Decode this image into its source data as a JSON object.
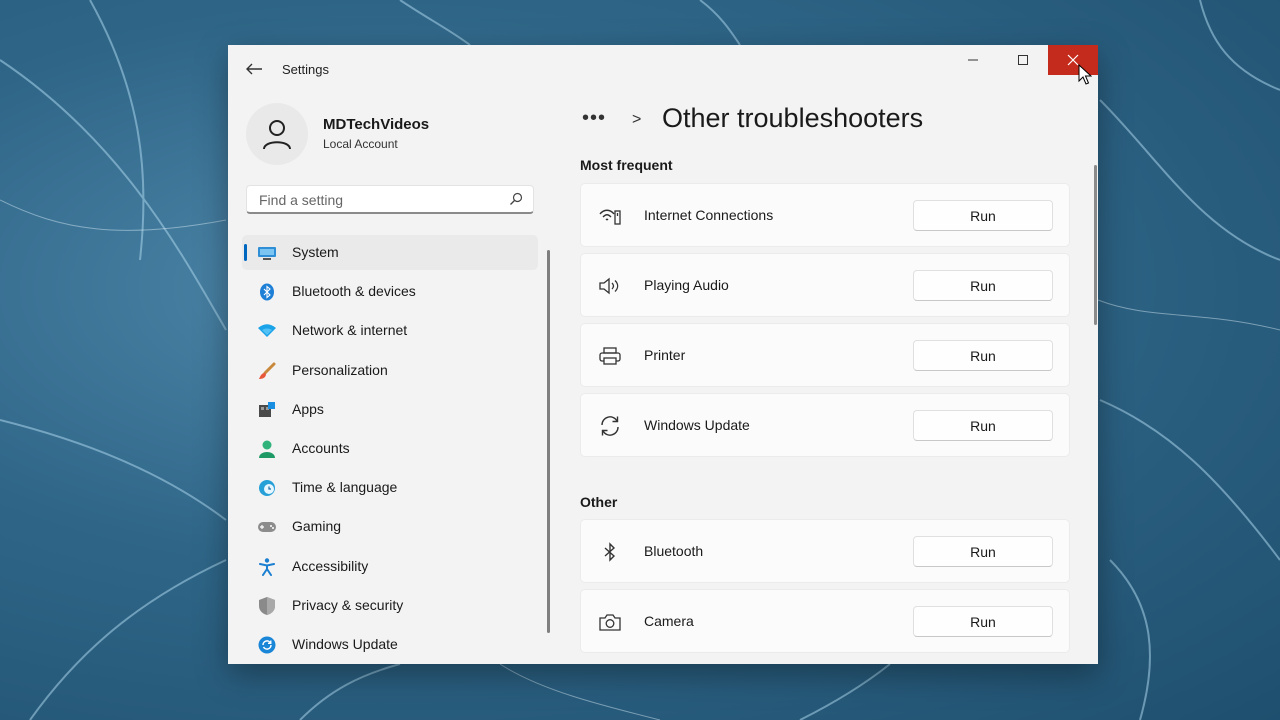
{
  "window": {
    "title": "Settings"
  },
  "profile": {
    "name": "MDTechVideos",
    "account_type": "Local Account"
  },
  "search": {
    "placeholder": "Find a setting"
  },
  "nav": {
    "items": [
      {
        "label": "System",
        "icon": "system-icon",
        "active": true
      },
      {
        "label": "Bluetooth & devices",
        "icon": "bluetooth-icon"
      },
      {
        "label": "Network & internet",
        "icon": "wifi-icon"
      },
      {
        "label": "Personalization",
        "icon": "brush-icon"
      },
      {
        "label": "Apps",
        "icon": "apps-icon"
      },
      {
        "label": "Accounts",
        "icon": "person-icon"
      },
      {
        "label": "Time & language",
        "icon": "globe-clock-icon"
      },
      {
        "label": "Gaming",
        "icon": "controller-icon"
      },
      {
        "label": "Accessibility",
        "icon": "accessibility-icon"
      },
      {
        "label": "Privacy & security",
        "icon": "shield-icon"
      },
      {
        "label": "Windows Update",
        "icon": "update-icon"
      }
    ]
  },
  "breadcrumb": {
    "more": "•••",
    "separator": ">",
    "title": "Other troubleshooters"
  },
  "sections": {
    "most_frequent": {
      "label": "Most frequent",
      "items": [
        {
          "label": "Internet Connections",
          "icon": "wifi-network-icon",
          "button": "Run"
        },
        {
          "label": "Playing Audio",
          "icon": "speaker-icon",
          "button": "Run"
        },
        {
          "label": "Printer",
          "icon": "printer-icon",
          "button": "Run"
        },
        {
          "label": "Windows Update",
          "icon": "refresh-icon",
          "button": "Run"
        }
      ]
    },
    "other": {
      "label": "Other",
      "items": [
        {
          "label": "Bluetooth",
          "icon": "bluetooth-icon",
          "button": "Run"
        },
        {
          "label": "Camera",
          "icon": "camera-icon",
          "button": "Run"
        }
      ]
    }
  },
  "colors": {
    "accent": "#0067c0",
    "close_hover": "#c42b1c",
    "window_bg": "#f3f3f3"
  }
}
